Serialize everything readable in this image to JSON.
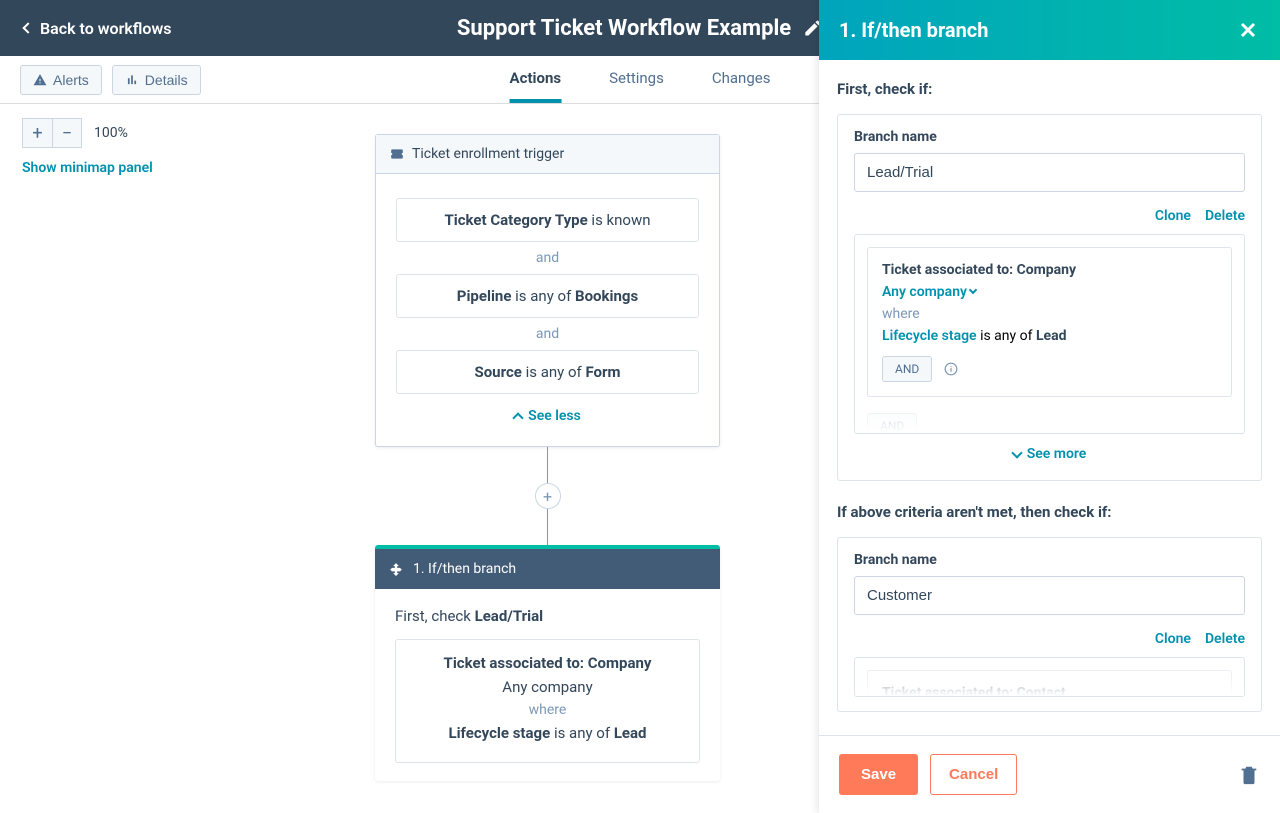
{
  "header": {
    "back": "Back to workflows",
    "title": "Support Ticket Workflow Example"
  },
  "toolbar": {
    "alerts": "Alerts",
    "details": "Details"
  },
  "tabs": {
    "actions": "Actions",
    "settings": "Settings",
    "changes": "Changes"
  },
  "zoom": {
    "level": "100%",
    "minimap": "Show minimap panel"
  },
  "trigger": {
    "title": "Ticket enrollment trigger",
    "cond1_prop": "Ticket Category Type",
    "cond1_rest": " is known",
    "and": "and",
    "cond2_prop": "Pipeline",
    "cond2_mid": " is any of ",
    "cond2_val": "Bookings",
    "cond3_prop": "Source",
    "cond3_mid": " is any of ",
    "cond3_val": "Form",
    "see_less": "See less"
  },
  "branch_card": {
    "title": "1. If/then branch",
    "check_prefix": "First, check ",
    "check_value": "Lead/Trial",
    "assoc_label": "Ticket associated to: Company",
    "any": "Any company",
    "where": "where",
    "lifecycle": "Lifecycle stage",
    "mid": " is any of ",
    "val": "Lead"
  },
  "panel": {
    "title": "1. If/then branch",
    "first_check": "First, check if:",
    "branch_name_label": "Branch name",
    "branch1_value": "Lead/Trial",
    "clone": "Clone",
    "delete": "Delete",
    "crit_assoc": "Ticket associated to: Company",
    "crit_any": "Any company",
    "crit_where": "where",
    "crit_life": "Lifecycle stage",
    "crit_mid": " is any of ",
    "crit_val": "Lead",
    "and": "AND",
    "see_more": "See more",
    "else_label": "If above criteria aren't met, then check if:",
    "branch2_value": "Customer",
    "crit2_assoc": "Ticket associated to: Contact",
    "save": "Save",
    "cancel": "Cancel"
  }
}
